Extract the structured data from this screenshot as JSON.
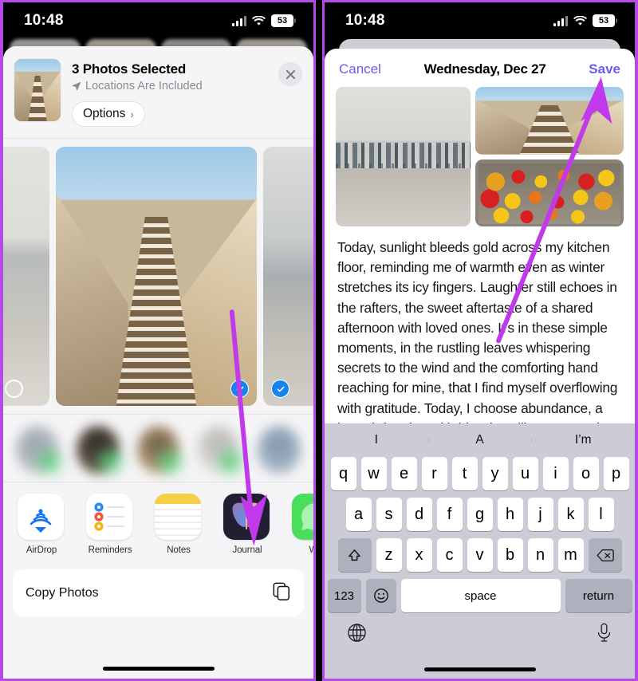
{
  "status_bar": {
    "time": "10:48",
    "battery_percent": "53",
    "cellular_icon": "cellular-bars-icon",
    "wifi_icon": "wifi-icon",
    "battery_icon": "battery-icon"
  },
  "left_panel": {
    "name": "ios-share-sheet",
    "share_sheet": {
      "title": "3 Photos Selected",
      "subtitle": "Locations Are Included",
      "location_icon": "location-arrow-icon",
      "options_label": "Options",
      "options_chevron": "chevron-right-icon",
      "close_icon": "close-icon",
      "thumbnail_alt": "stairs-photo"
    },
    "photo_strip": [
      {
        "alt": "shoreline-photo",
        "selected": false
      },
      {
        "alt": "stairs-photo",
        "selected": true
      },
      {
        "alt": "ghat-photo",
        "selected": true
      }
    ],
    "contacts_row": {
      "count": 5,
      "blurred": true,
      "badge_color": "#5ad07e"
    },
    "apps": [
      {
        "label": "AirDrop",
        "icon": "airdrop-icon"
      },
      {
        "label": "Reminders",
        "icon": "reminders-icon"
      },
      {
        "label": "Notes",
        "icon": "notes-icon"
      },
      {
        "label": "Journal",
        "icon": "journal-icon"
      },
      {
        "label": "Wh",
        "icon": "whatsapp-icon"
      }
    ],
    "action_row": {
      "label": "Copy Photos",
      "icon": "copy-icon"
    }
  },
  "right_panel": {
    "name": "journal-new-entry",
    "nav": {
      "cancel_label": "Cancel",
      "title": "Wednesday, Dec 27",
      "save_label": "Save"
    },
    "photos": [
      {
        "alt": "harbor-boats-photo"
      },
      {
        "alt": "stairs-photo"
      },
      {
        "alt": "marigold-flowers-photo"
      }
    ],
    "entry_text": "Today, sunlight bleeds gold across my kitchen floor, reminding me of warmth even as winter stretches its icy fingers. Laughter still echoes in the rafters, the sweet aftertaste of a shared afternoon with loved ones. It's in these simple moments, in the rustling leaves whispering secrets to the wind and the comforting hand reaching for mine, that I find myself overflowing with gratitude. Today, I choose abundance, a heart brimming with blessings like a starry sky,",
    "keyboard": {
      "suggestions": [
        "I",
        "A",
        "I’m"
      ],
      "row1": [
        "q",
        "w",
        "e",
        "r",
        "t",
        "y",
        "u",
        "i",
        "o",
        "p"
      ],
      "row2": [
        "a",
        "s",
        "d",
        "f",
        "g",
        "h",
        "j",
        "k",
        "l"
      ],
      "row3": [
        "z",
        "x",
        "c",
        "v",
        "b",
        "n",
        "m"
      ],
      "shift_icon": "shift-icon",
      "backspace_icon": "backspace-icon",
      "numbers_label": "123",
      "emoji_icon": "emoji-icon",
      "space_label": "space",
      "return_label": "return",
      "globe_icon": "globe-icon",
      "mic_icon": "microphone-icon"
    }
  },
  "annotations": {
    "accent_color": "#c03aec",
    "arrow_left": "arrow-pointing-to-journal-app",
    "arrow_right": "arrow-pointing-to-save-button"
  }
}
